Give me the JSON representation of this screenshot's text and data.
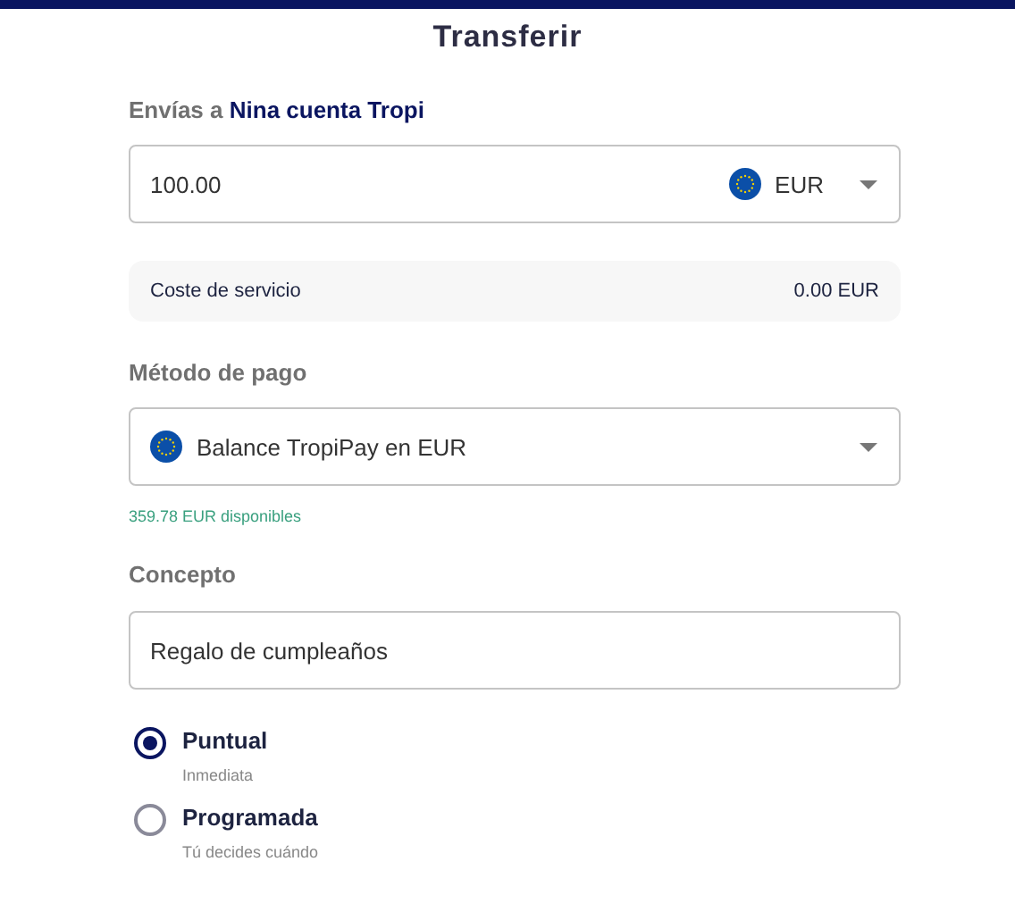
{
  "title": "Transferir",
  "recipient_label": "Envías a **Nina cuenta Tropi**",
  "amount": {
    "value": "100.00",
    "currency": "EUR"
  },
  "service_fee": {
    "label": "Coste de servicio",
    "value": "0.00 EUR"
  },
  "payment_method": {
    "label": "Método de pago",
    "value": "Balance TropiPay en EUR",
    "available": "359.78 EUR disponibles"
  },
  "concept": {
    "label": "Concepto",
    "value": "Regalo de cumpleaños"
  },
  "timing_options": [
    {
      "label": "Puntual",
      "description": "Inmediata",
      "selected": true
    },
    {
      "label": "Programada",
      "description": "Tú decides cuándo",
      "selected": false
    }
  ]
}
